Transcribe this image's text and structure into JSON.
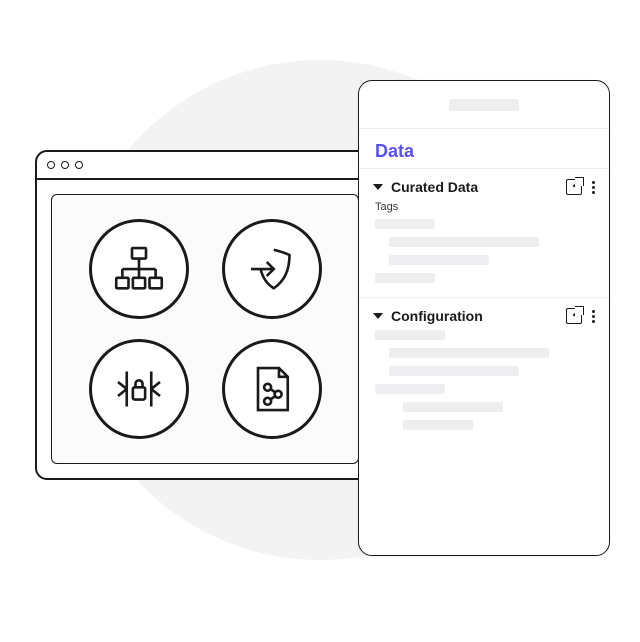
{
  "illustration": {
    "browser": {
      "icons": [
        {
          "name": "hierarchy-icon"
        },
        {
          "name": "shield-login-icon"
        },
        {
          "name": "secure-gateway-icon"
        },
        {
          "name": "share-document-icon"
        }
      ],
      "chip": {
        "name": "processor-chip-icon"
      }
    }
  },
  "panel": {
    "title": "Data",
    "sections": [
      {
        "id": "curated",
        "title": "Curated Data",
        "subtitle": "Tags",
        "expanded": true
      },
      {
        "id": "configuration",
        "title": "Configuration",
        "expanded": true
      }
    ]
  },
  "colors": {
    "accent": "#5a4ff3",
    "ink": "#1a1a1a",
    "placeholder": "#eeedf0",
    "bgcircle": "#f3f3f4"
  }
}
